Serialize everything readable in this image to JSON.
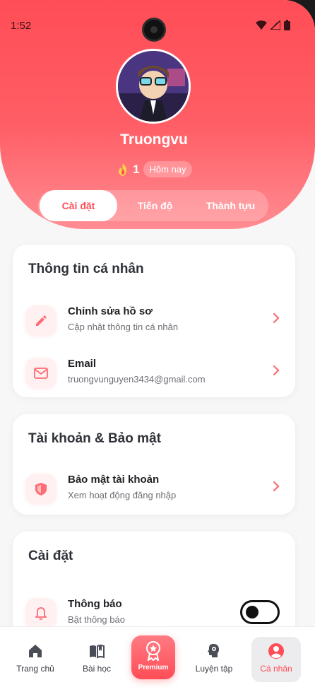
{
  "status": {
    "time": "1:52"
  },
  "profile": {
    "name": "Truongvu",
    "streak_count": "1",
    "streak_label": "Hôm nay"
  },
  "tabs": [
    {
      "label": "Cài đặt"
    },
    {
      "label": "Tiến độ"
    },
    {
      "label": "Thành tựu"
    }
  ],
  "sections": {
    "personal": {
      "title": "Thông tin cá nhân",
      "items": [
        {
          "title": "Chỉnh sửa hồ sơ",
          "subtitle": "Cập nhật thông tin cá nhân",
          "icon": "pencil-icon"
        },
        {
          "title": "Email",
          "subtitle": "truongvunguyen3434@gmail.com",
          "icon": "mail-icon"
        }
      ]
    },
    "security": {
      "title": "Tài khoản & Bảo mật",
      "items": [
        {
          "title": "Bảo mật tài khoản",
          "subtitle": "Xem hoạt động đăng nhập",
          "icon": "shield-icon"
        }
      ]
    },
    "settings": {
      "title": "Cài đặt",
      "items": [
        {
          "title": "Thông báo",
          "subtitle": "Bật thông báo",
          "icon": "bell-icon",
          "toggle": "off"
        }
      ]
    }
  },
  "nav": [
    {
      "label": "Trang chủ",
      "icon": "home-icon"
    },
    {
      "label": "Bài học",
      "icon": "book-icon"
    },
    {
      "label": "Premium",
      "icon": "badge-icon"
    },
    {
      "label": "Luyện tập",
      "icon": "brain-icon"
    },
    {
      "label": "Cá nhân",
      "icon": "user-icon",
      "active": true
    }
  ],
  "colors": {
    "accent": "#ff4d57",
    "accent_light": "#fff1f1"
  }
}
